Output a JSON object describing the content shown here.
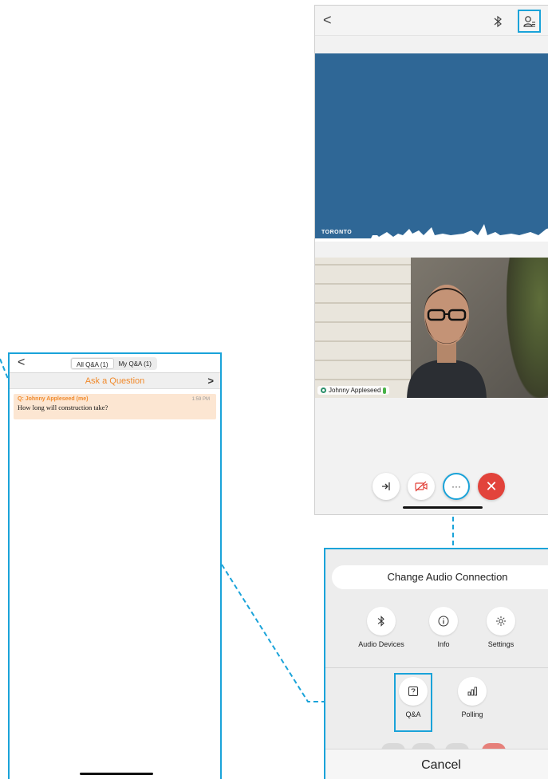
{
  "qa_screen": {
    "back_symbol": "<",
    "tabs": [
      {
        "label": "All Q&A (1)",
        "active": true
      },
      {
        "label": "My Q&A (1)",
        "active": false
      }
    ],
    "ask_label": "Ask a Question",
    "ask_chevron": ">",
    "question": {
      "author": "Q: Johnny Appleseed (me)",
      "time": "1:59 PM",
      "text": "How long will construction take?"
    }
  },
  "meeting_screen": {
    "back_symbol": "<",
    "share_logo_text": "TORONTO",
    "participant_name": "Johnny Appleseed",
    "controls": [
      "audio-icon",
      "video-off-icon",
      "more-icon",
      "end-call-icon"
    ],
    "more_symbol": "···",
    "end_symbol": "✕"
  },
  "more_menu": {
    "change_audio_label": "Change Audio Connection",
    "row1": [
      {
        "label": "Audio Devices",
        "icon": "bluetooth-icon"
      },
      {
        "label": "Info",
        "icon": "info-icon"
      },
      {
        "label": "Settings",
        "icon": "settings-icon"
      }
    ],
    "row2": [
      {
        "label": "Q&A",
        "icon": "qa-icon"
      },
      {
        "label": "Polling",
        "icon": "polling-icon"
      }
    ],
    "cancel_label": "Cancel"
  },
  "colors": {
    "accent": "#1aa3d9",
    "orange": "#f08a2c",
    "share_blue": "#2f6796",
    "end_red": "#e2433b"
  }
}
